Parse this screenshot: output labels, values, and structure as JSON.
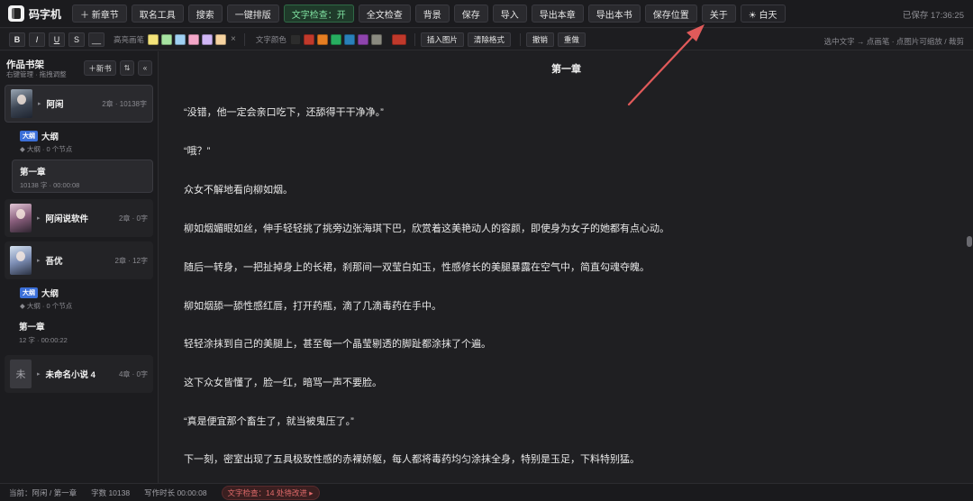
{
  "app": {
    "title": "码字机"
  },
  "toolbar": {
    "buttons": [
      {
        "label": "＋ 新章节",
        "name": "new-chapter-button"
      },
      {
        "label": "取名工具",
        "name": "naming-tool-button"
      },
      {
        "label": "搜索",
        "name": "search-button"
      },
      {
        "label": "一键排版",
        "name": "auto-format-button"
      },
      {
        "label": "文字检查：开",
        "name": "text-check-toggle",
        "style": "green"
      },
      {
        "label": "全文检查",
        "name": "full-check-button"
      },
      {
        "label": "背景",
        "name": "background-button"
      },
      {
        "label": "保存",
        "name": "save-button"
      },
      {
        "label": "导入",
        "name": "import-button"
      },
      {
        "label": "导出本章",
        "name": "export-chapter-button"
      },
      {
        "label": "导出本书",
        "name": "export-book-button"
      },
      {
        "label": "保存位置",
        "name": "save-location-button"
      },
      {
        "label": "关于",
        "name": "about-button"
      },
      {
        "label": "☀ 白天",
        "name": "day-mode-toggle",
        "style": "sun"
      }
    ],
    "saved_status": "已保存 17:36:25"
  },
  "format_bar": {
    "buttons": [
      "B",
      "I",
      "U",
      "S",
      "__"
    ],
    "highlight_label": "高亮画笔",
    "highlight_colors": [
      "#f3e37a",
      "#a6e3a1",
      "#9fd0f2",
      "#f3a6c8",
      "#d0b6f5",
      "#f6d3a0"
    ],
    "clear_symbol": "×",
    "text_color_label": "文字颜色",
    "text_colors": [
      "#2c2c2c",
      "#c0392b",
      "#e67e22",
      "#27ae60",
      "#2980b9",
      "#8e44ad",
      "#8a8a80"
    ],
    "current_text_color": "#c0392b",
    "insert_image": "插入图片",
    "clear_format": "清除格式",
    "undo": "撤销",
    "redo": "重做",
    "hint": "选中文字 → 点画笔 · 点图片可缩放 / 裁剪"
  },
  "sidebar": {
    "title": "作品书架",
    "subtitle": "右键管理 · 拖拽调整",
    "new_label": "＋新书",
    "sort_icon": "⇅",
    "collapse_icon": "«",
    "books": [
      {
        "name": "阿闲",
        "meta": "2章 · 10138字",
        "cover": "c1"
      },
      {
        "name": "阿闲说软件",
        "meta": "2章 · 0字",
        "cover": "c2"
      },
      {
        "name": "吾优",
        "meta": "2章 · 12字",
        "cover": "c3"
      },
      {
        "name": "未命名小说 4",
        "meta": "4章 · 0字",
        "cover": "placeholder",
        "cover_text": "未"
      }
    ],
    "outline_badge": "大纲",
    "outline_name": "大纲",
    "outline_sub": "◆ 大纲 · 0 个节点",
    "chapters": [
      {
        "name": "第一章",
        "sub": "10138 字 · 00:00:08"
      },
      {
        "name": "第一章",
        "sub": "12 字 · 00:00:22"
      }
    ]
  },
  "editor": {
    "chapter_title": "第一章",
    "paragraphs": [
      "“没错，他一定会亲口吃下，还舔得干干净净。”",
      "“哦？”",
      "众女不解地看向柳如烟。",
      "柳如烟媚眼如丝，伸手轻轻挑了挑旁边张海琪下巴，欣赏着这美艳动人的容颜，即使身为女子的她都有点心动。",
      "随后一转身，一把扯掉身上的长裙，刹那间一双莹白如玉，性感修长的美腿暴露在空气中，简直勾魂夺魄。",
      "柳如烟舔一舔性感红唇，打开药瓶，滴了几滴毒药在手中。",
      "轻轻涂抹到自己的美腿上，甚至每一个晶莹剔透的脚趾都涂抹了个遍。",
      "这下众女皆懂了，脸一红，暗骂一声不要脸。",
      "“真是便宜那个畜生了，就当被鬼压了。”",
      "下一刻，密室出现了五具极致性感的赤裸娇躯，每人都将毒药均匀涂抹全身，特别是玉足，下料特别猛。"
    ]
  },
  "statusbar": {
    "location": "当前：阿闲 / 第一章",
    "word_count": "字数 10138",
    "writing_time": "写作时长 00:00:08",
    "text_check": "文字检查：14 处待改进 ▸"
  },
  "colors": {
    "accent_green": "#7fe0a0",
    "badge_blue": "#3b6fd8",
    "arrow_red": "#e05a5a",
    "warn_red": "#e06a6a"
  }
}
